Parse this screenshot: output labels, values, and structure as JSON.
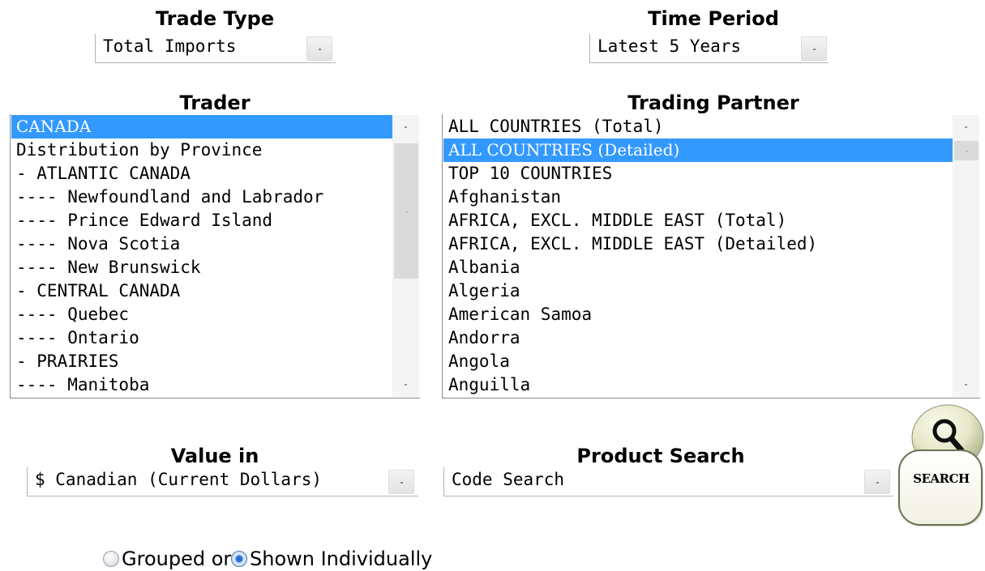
{
  "trade_type": {
    "label": "Trade Type",
    "value": "Total Imports"
  },
  "time_period": {
    "label": "Time Period",
    "value": "Latest 5 Years"
  },
  "trader": {
    "label": "Trader",
    "items": [
      "CANADA",
      "Distribution by Province",
      "- ATLANTIC CANADA",
      "---- Newfoundland and Labrador",
      "---- Prince Edward Island",
      "---- Nova Scotia",
      "---- New Brunswick",
      "- CENTRAL CANADA",
      "---- Quebec",
      "---- Ontario",
      "- PRAIRIES",
      "---- Manitoba"
    ],
    "selected_index": 0
  },
  "trading_partner": {
    "label": "Trading Partner",
    "items": [
      "ALL COUNTRIES (Total)",
      "ALL COUNTRIES (Detailed)",
      "TOP 10 COUNTRIES",
      "Afghanistan",
      "AFRICA, EXCL. MIDDLE EAST (Total)",
      "AFRICA, EXCL. MIDDLE EAST (Detailed)",
      "Albania",
      "Algeria",
      "American Samoa",
      "Andorra",
      "Angola",
      "Anguilla"
    ],
    "selected_index": 1
  },
  "value_in": {
    "label": "Value in",
    "value": "$ Canadian (Current Dollars)"
  },
  "product_search": {
    "label": "Product Search",
    "value": "Code Search"
  },
  "search_button": {
    "label": "SEARCH",
    "icon": "magnifier-icon"
  },
  "display_mode": {
    "option_grouped": "Grouped or",
    "option_individual": "Shown Individually",
    "selected": "Shown Individually"
  },
  "colors": {
    "selection": "#3399ff",
    "selection_text": "#ffffff",
    "scrollbar_track": "#f4f4f4",
    "scrollbar_thumb": "#dadada"
  }
}
